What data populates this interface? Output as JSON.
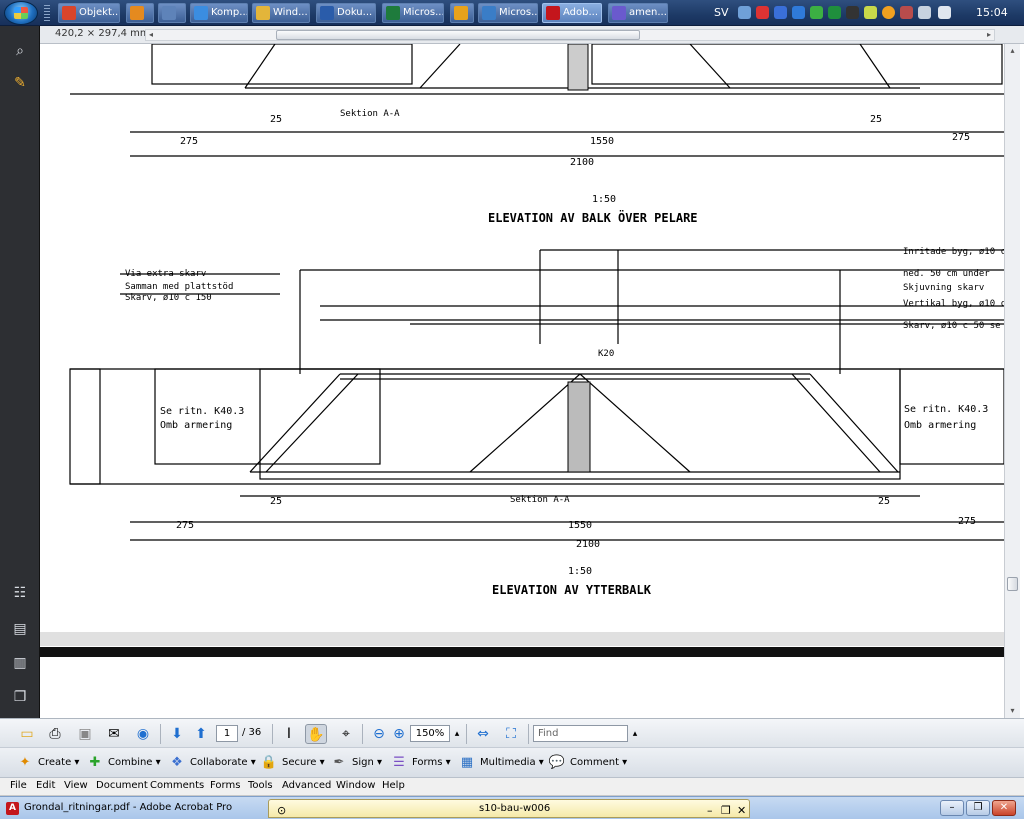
{
  "taskbar": {
    "buttons": [
      {
        "label": "Objekt...",
        "icon": "pdf-icon",
        "color": "#d9452b"
      },
      {
        "label": "",
        "icon": "media-icon",
        "color": "#e58a1f"
      },
      {
        "label": "",
        "icon": "plane-icon",
        "color": "#5e83b9"
      },
      {
        "label": "Komp...",
        "icon": "computer-icon",
        "color": "#3b8de0"
      },
      {
        "label": "Wind...",
        "icon": "folder-icon",
        "color": "#e3b53a"
      },
      {
        "label": "Doku...",
        "icon": "word-icon",
        "color": "#2a5caa"
      },
      {
        "label": "Micros...",
        "icon": "excel-icon",
        "color": "#1e7b3c"
      },
      {
        "label": "",
        "icon": "outlook-icon",
        "color": "#e7a21b"
      },
      {
        "label": "Micros...",
        "icon": "project-icon",
        "color": "#3a7dc7"
      },
      {
        "label": "Adob...",
        "icon": "acrobat-icon",
        "color": "#c4161c"
      },
      {
        "label": "amen...",
        "icon": "app-icon",
        "color": "#6a5acd"
      }
    ],
    "lang": "SV",
    "clock": "15:04"
  },
  "status": {
    "page_size": "420,2 × 297,4 mm"
  },
  "drawing": {
    "title_top": "ELEVATION AV BALK ÖVER PELARE",
    "title_bottom": "ELEVATION AV YTTERBALK",
    "scale": "1:50",
    "dim_total": "2100",
    "dim_mid": "1550",
    "dim_left": "275",
    "dim_right": "275",
    "dim_small": "25",
    "note_left_1": "Skarv, ø10 c 150",
    "note_left_2": "Via extra skarv",
    "note_left_3": "Samman med plattstöd",
    "note_right_1": "Skarv, ø10 c 50 se",
    "note_right_2": "Vertikal byg, ø10 c",
    "note_right_3": "Skjuvning skarv",
    "note_right_4": "ned. 50 cm under",
    "note_right_5": "Inritade byg, ø10 c",
    "lbl_omb": "Omb armering",
    "lbl_se": "Se ritn. K40.3",
    "lbl_sek": "Sektion A-A",
    "lbl_k": "K20"
  },
  "toolbar": {
    "page_current": "1",
    "page_total": "/ 36",
    "zoom": "150%",
    "find_placeholder": "Find"
  },
  "tasks": [
    {
      "label": "Create",
      "icon": "create-icon"
    },
    {
      "label": "Combine",
      "icon": "combine-icon"
    },
    {
      "label": "Collaborate",
      "icon": "collaborate-icon"
    },
    {
      "label": "Secure",
      "icon": "secure-icon"
    },
    {
      "label": "Sign",
      "icon": "sign-icon"
    },
    {
      "label": "Forms",
      "icon": "forms-icon"
    },
    {
      "label": "Multimedia",
      "icon": "multimedia-icon"
    },
    {
      "label": "Comment",
      "icon": "comment-icon"
    }
  ],
  "menu": [
    "File",
    "Edit",
    "View",
    "Document",
    "Comments",
    "Forms",
    "Tools",
    "Advanced",
    "Window",
    "Help"
  ],
  "window": {
    "title": "Grondal_ritningar.pdf - Adobe Acrobat Pro",
    "doc_tab": "s10-bau-w006"
  }
}
